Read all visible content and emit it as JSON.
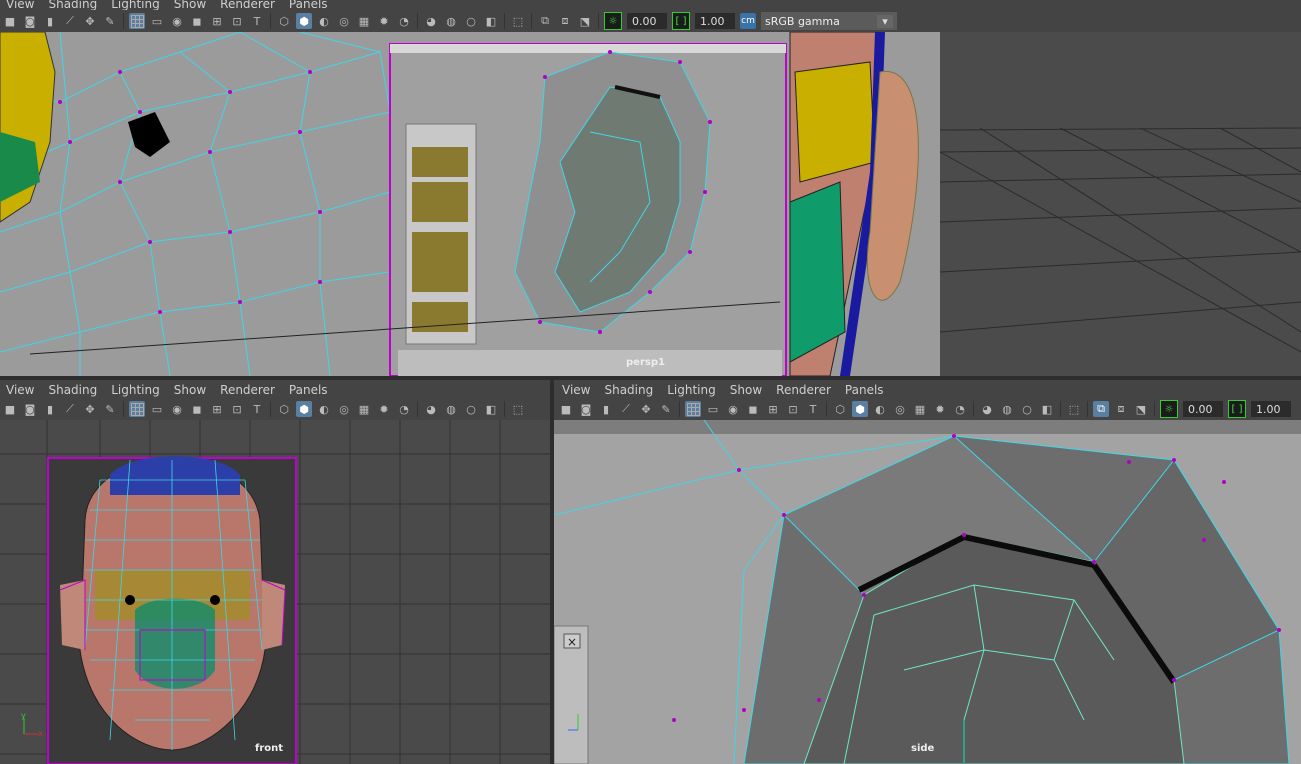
{
  "menu": {
    "view": "View",
    "shading": "Shading",
    "lighting": "Lighting",
    "show": "Show",
    "renderer": "Renderer",
    "panels": "Panels"
  },
  "top_toolbar": {
    "exposure": "0.00",
    "gamma": "1.00",
    "color_space": "sRGB gamma"
  },
  "bottom_right_toolbar": {
    "exposure": "0.00",
    "gamma": "1.00"
  },
  "viewports": {
    "top": "persp1",
    "bottom_left": "front",
    "bottom_right": "side"
  },
  "icons": [
    "camera-icon",
    "bookmark-icon",
    "grid-icon",
    "wireframe-icon",
    "smooth-shade-icon",
    "light-icon",
    "isolate-icon",
    "exposure-icon",
    "gamma-icon",
    "color-management-icon"
  ],
  "colors": {
    "panel": "#444444",
    "wire": "#3fd6e8",
    "vertex": "#b000c8",
    "selection": "#c000d0",
    "viewport_bg": "#4a4a4a"
  }
}
